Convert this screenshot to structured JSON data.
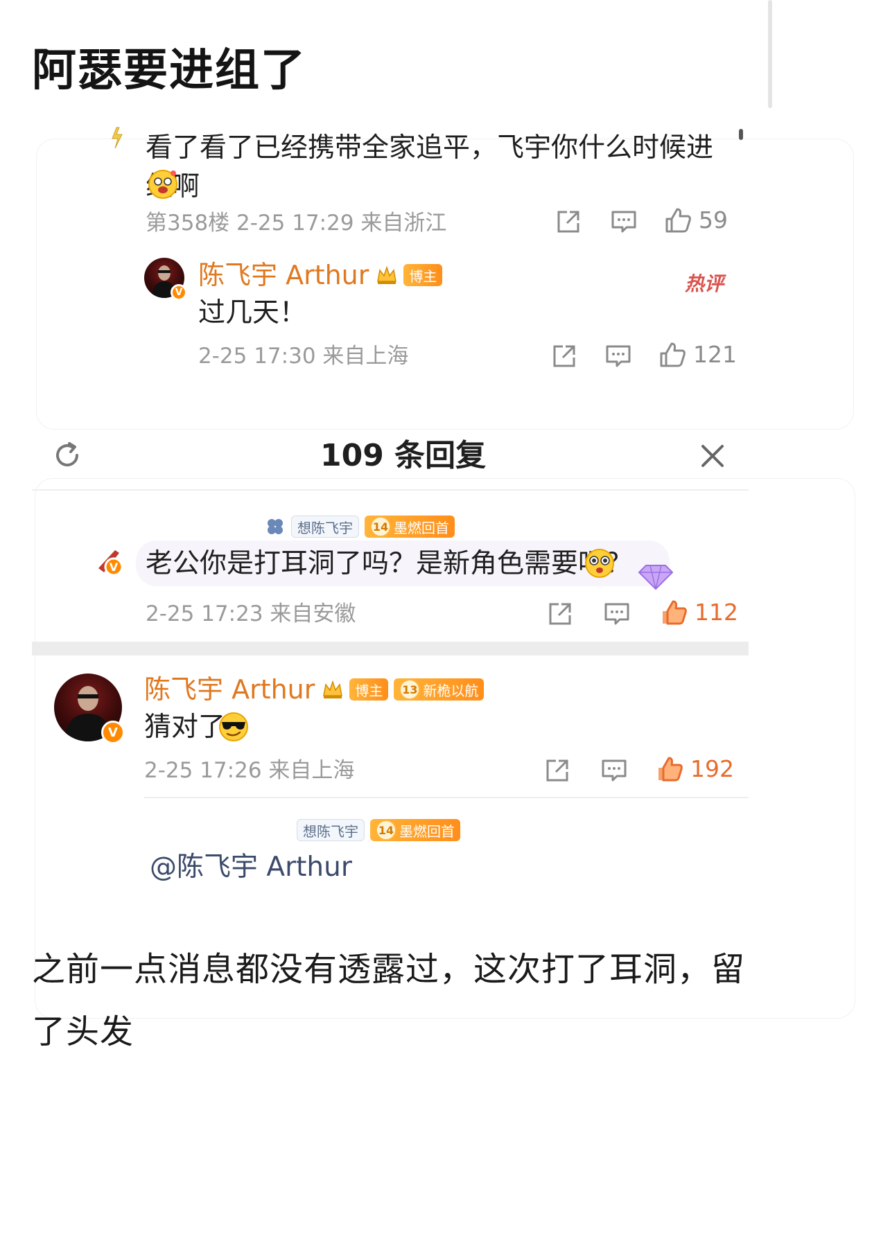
{
  "post": {
    "title": "阿瑟要进组了"
  },
  "comment1": {
    "text": "看了看了已经携带全家追平，飞宇你什么时候进组啊",
    "meta": "第358楼 2-25 17:29 来自浙江",
    "likes": "59",
    "reply": {
      "author": "陈飞宇 Arthur",
      "badge": "博主",
      "text": "过几天！",
      "meta": "2-25 17:30 来自上海",
      "likes": "121",
      "tag": "热评"
    }
  },
  "panel": {
    "title": "109 条回复",
    "reply1": {
      "author_badge": "想陈飞宇",
      "level": "14",
      "fan_badge": "墨燃回首",
      "text": "老公你是打耳洞了吗？是新角色需要吗？",
      "meta": "2-25 17:23 来自安徽",
      "likes": "112"
    },
    "reply2": {
      "author": "陈飞宇 Arthur",
      "badge": "博主",
      "level": "13",
      "fan_badge": "新桅以航",
      "text": "猜对了",
      "meta": "2-25 17:26 来自上海",
      "likes": "192"
    },
    "reply3": {
      "author_badge": "想陈飞宇",
      "level": "14",
      "fan_badge": "墨燃回首",
      "mention": "@陈飞宇 Arthur"
    }
  },
  "footer": {
    "paragraph": "之前一点消息都没有透露过，这次打了耳洞，留了头发"
  },
  "colors": {
    "accent": "#e0781f",
    "like_active": "#e86b2c",
    "meta": "#9a9a9a"
  },
  "icons": [
    "share-icon",
    "comment-icon",
    "like-icon",
    "refresh-icon",
    "close-icon",
    "verified-icon"
  ]
}
